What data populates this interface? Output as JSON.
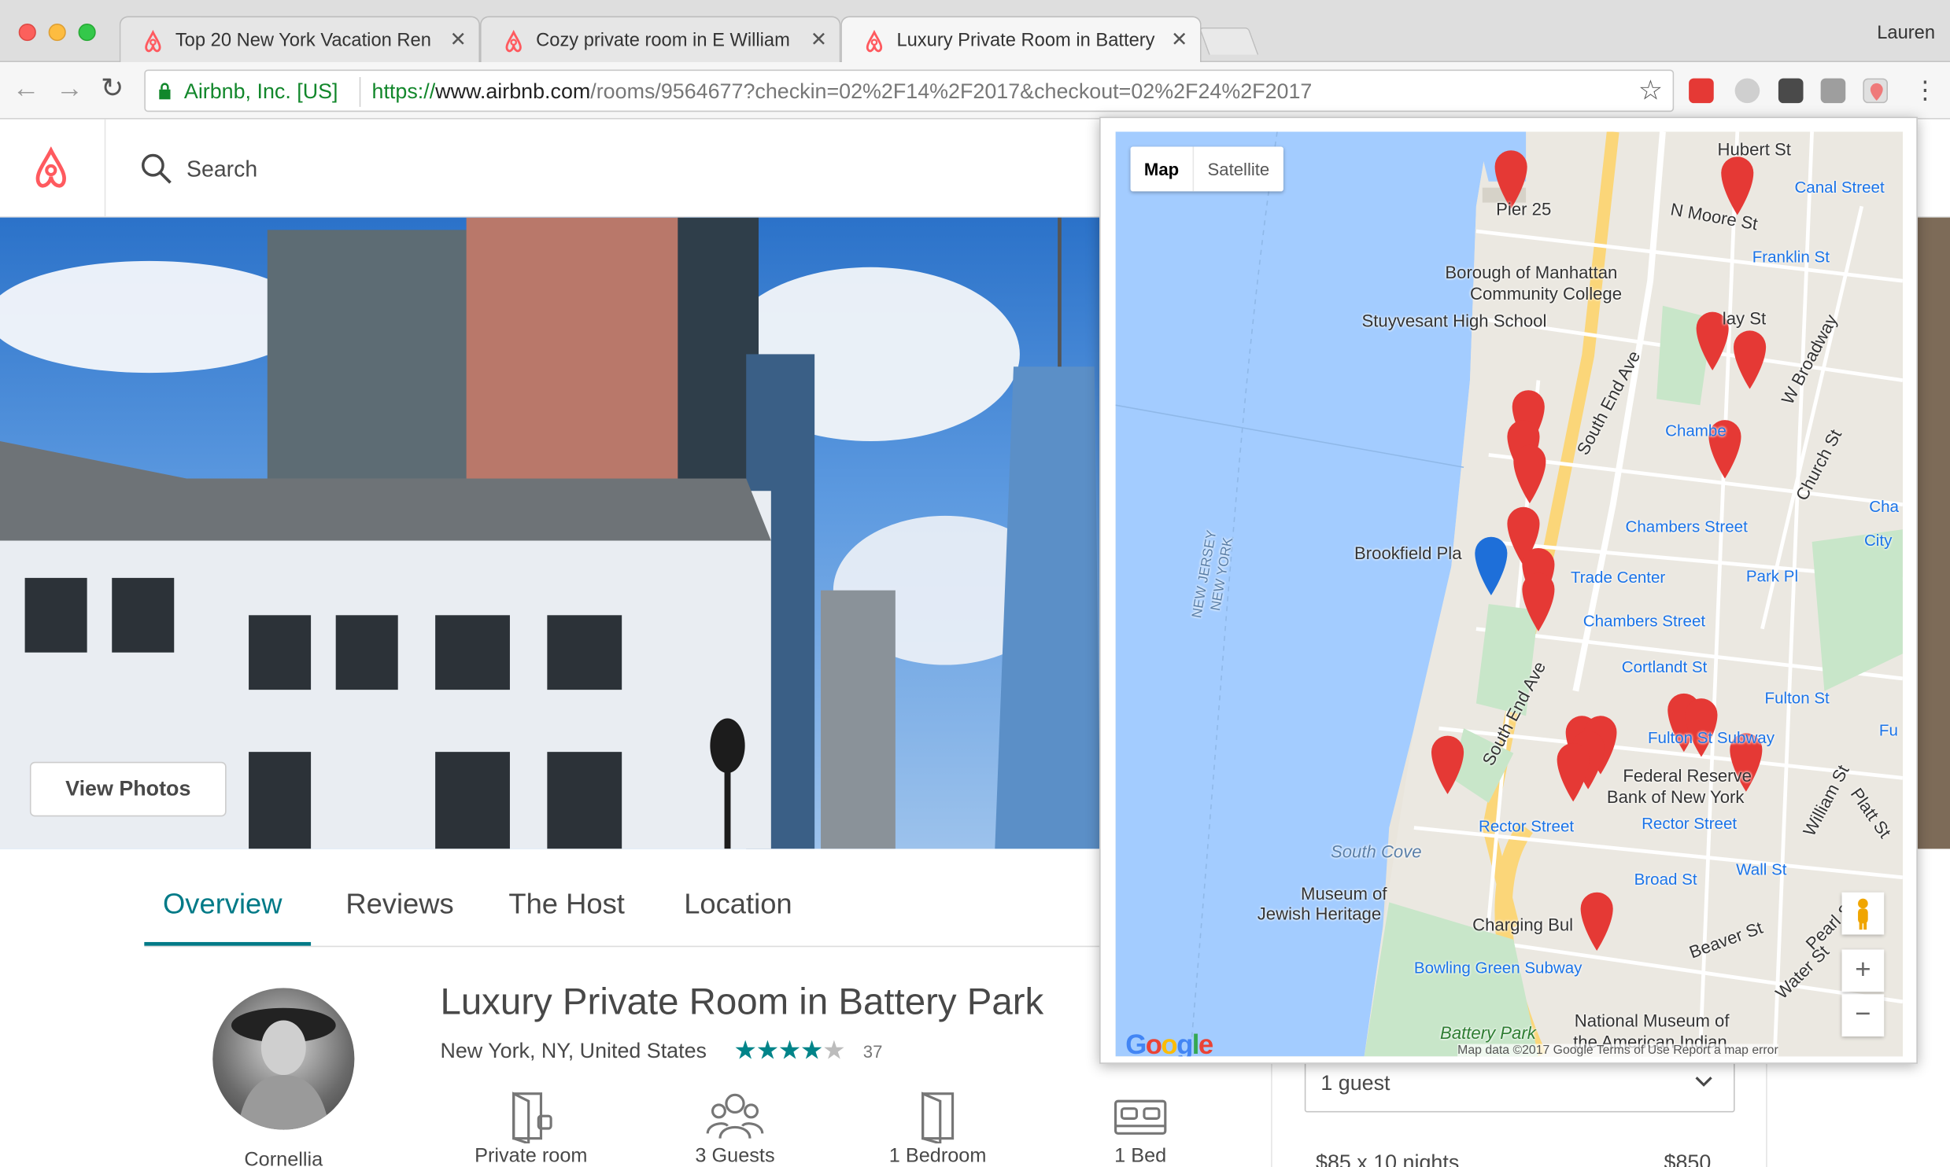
{
  "browser": {
    "tabs": [
      {
        "title": "Top 20 New York Vacation Ren"
      },
      {
        "title": "Cozy private room in E William"
      },
      {
        "title": "Luxury Private Room in Battery"
      }
    ],
    "profile": "Lauren",
    "address": {
      "ev_label": "Airbnb, Inc. [US]",
      "scheme": "https://",
      "host": "www.airbnb.com",
      "path": "/rooms/9564677?checkin=02%2F14%2F2017&checkout=02%2F24%2F2017"
    }
  },
  "header": {
    "search_placeholder": "Search"
  },
  "hero": {
    "view_photos": "View Photos"
  },
  "page_tabs": [
    "Overview",
    "Reviews",
    "The Host",
    "Location"
  ],
  "listing": {
    "title": "Luxury Private Room in Battery Park",
    "location": "New York, NY, United States",
    "rating_stars": 4.5,
    "review_count": "37",
    "host_name": "Cornellia"
  },
  "amenities": [
    {
      "icon": "private-room-icon",
      "label": "Private room"
    },
    {
      "icon": "guests-icon",
      "label": "3 Guests"
    },
    {
      "icon": "bedroom-icon",
      "label": "1 Bedroom"
    },
    {
      "icon": "bed-icon",
      "label": "1 Bed"
    }
  ],
  "booking": {
    "guests_value": "1 guest",
    "price_line_left": "$85 x 10 nights",
    "price_line_right": "$850"
  },
  "map_popup": {
    "map_type_map": "Map",
    "map_type_satellite": "Satellite",
    "zoom_in": "+",
    "zoom_out": "−",
    "google": "Google",
    "map_data": "Map data ©2017 Google   Terms of Use   Report a map error",
    "labels": {
      "pier25": "Pier 25",
      "bmcc1": "Borough of Manhattan",
      "bmcc2": "Community College",
      "stuy": "Stuyvesant High School",
      "brookfield": "Brookfield Pla",
      "southend1": "South End Ave",
      "southend2": "South End Ave",
      "southcove": "South Cove",
      "museum1": "Museum of",
      "museum2": "Jewish Heritage",
      "charging": "Charging Bul",
      "bowling": "Bowling Green Subway",
      "battery": "Battery Park",
      "nmai1": "National Museum of",
      "nmai2": "the American Indian",
      "fed1": "Federal Reserve",
      "fed2": "Bank of New York",
      "rector1": "Rector Street",
      "rector2": "Rector Street",
      "wall": "Wall St",
      "broad": "Broad St",
      "beaver": "Beaver St",
      "canal": "Canal Street",
      "franklin": "Franklin St",
      "nmoore": "N Moore St",
      "chambers1": "Chambers Street",
      "chambers2": "Chambers Street",
      "chambe": "Chambe",
      "cha": "Cha",
      "cityhall": "City",
      "parkpl": "Park Pl",
      "cortlandt": "Cortlandt St",
      "fulton1": "Fulton St",
      "fulton2": "Fulton St",
      "fultonsub": "Fulton St Subway",
      "tradecenter": "Trade Center",
      "hubert": "Hubert St",
      "wbroadway": "W Broadway",
      "church": "Church St",
      "william": "William St",
      "platt": "Platt St",
      "pearl": "Pearl St",
      "water": "Water St",
      "njny1": "NEW JERSEY",
      "njny2": "NEW YORK",
      "laySt": "lay St",
      "fultonR": "Fu"
    }
  },
  "colors": {
    "airbnb_red": "#ff5a5f",
    "teal": "#007a87",
    "star_teal": "#008489",
    "map_water": "#a3ccff",
    "map_pin": "#e53935",
    "selected_pin": "#1e6fd9"
  }
}
